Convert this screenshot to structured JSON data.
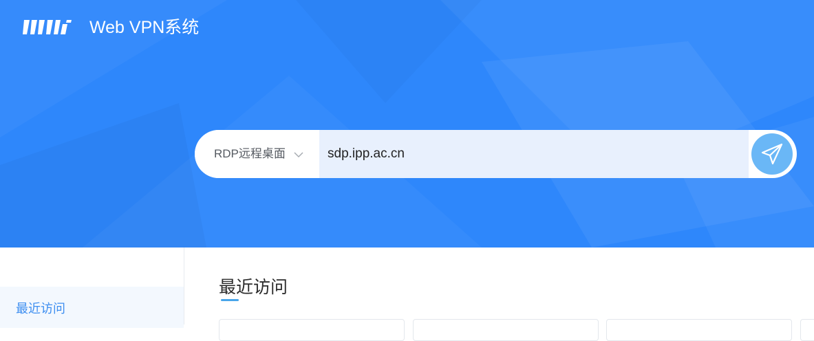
{
  "header": {
    "logo_icon": "school-logo-icon",
    "title": "Web VPN系统"
  },
  "search": {
    "mode_label": "RDP远程桌面",
    "mode_icon": "chevron-down-icon",
    "url_value": "sdp.ipp.ac.cn",
    "go_icon": "paper-plane-icon"
  },
  "sidebar": {
    "items": [
      {
        "label": "最近访问"
      }
    ]
  },
  "main": {
    "section_title": "最近访问"
  },
  "colors": {
    "hero_background": "#2e87fb",
    "accent": "#3d8ef0",
    "go_button": "#6ab7f6",
    "input_background": "#e8f0fd",
    "underline": "#49a5ea"
  }
}
